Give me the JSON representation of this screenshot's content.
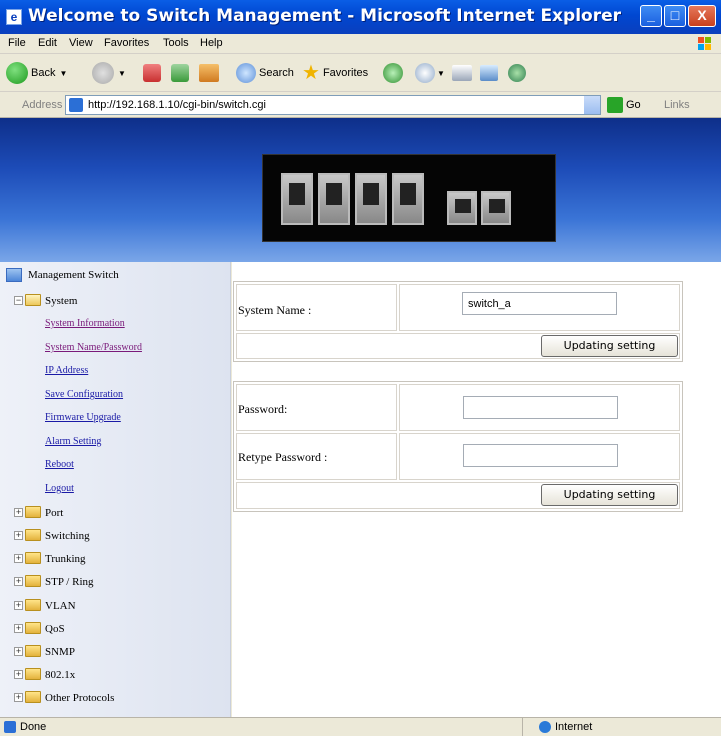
{
  "window": {
    "title": "Welcome to Switch Management - Microsoft Internet Explorer",
    "minimize_glyph": "_",
    "maximize_glyph": "□",
    "close_glyph": "X"
  },
  "menu": [
    "File",
    "Edit",
    "View",
    "Favorites",
    "Tools",
    "Help"
  ],
  "toolbar": {
    "back": "Back",
    "search": "Search",
    "favorites": "Favorites"
  },
  "address": {
    "label": "Address",
    "url": "http://192.168.1.10/cgi-bin/switch.cgi",
    "go": "Go",
    "links": "Links"
  },
  "tree": {
    "root": "Management Switch",
    "system": {
      "label": "System",
      "expander": "−",
      "items": [
        "System Information",
        "System Name/Password",
        "IP Address",
        "Save Configuration",
        "Firmware Upgrade",
        "Alarm Setting",
        "Reboot",
        "Logout"
      ]
    },
    "folders": [
      "Port",
      "Switching",
      "Trunking",
      "STP / Ring",
      "VLAN",
      "QoS",
      "SNMP",
      "802.1x",
      "Other Protocols"
    ],
    "expander": "+"
  },
  "form1": {
    "label": "System Name :",
    "value": "switch_a",
    "button": "Updating setting"
  },
  "form2": {
    "password_label": "Password:",
    "retype_label": "Retype Password :",
    "password_value": "",
    "retype_value": "",
    "button": "Updating setting"
  },
  "status": {
    "text": "Done",
    "zone": "Internet"
  }
}
